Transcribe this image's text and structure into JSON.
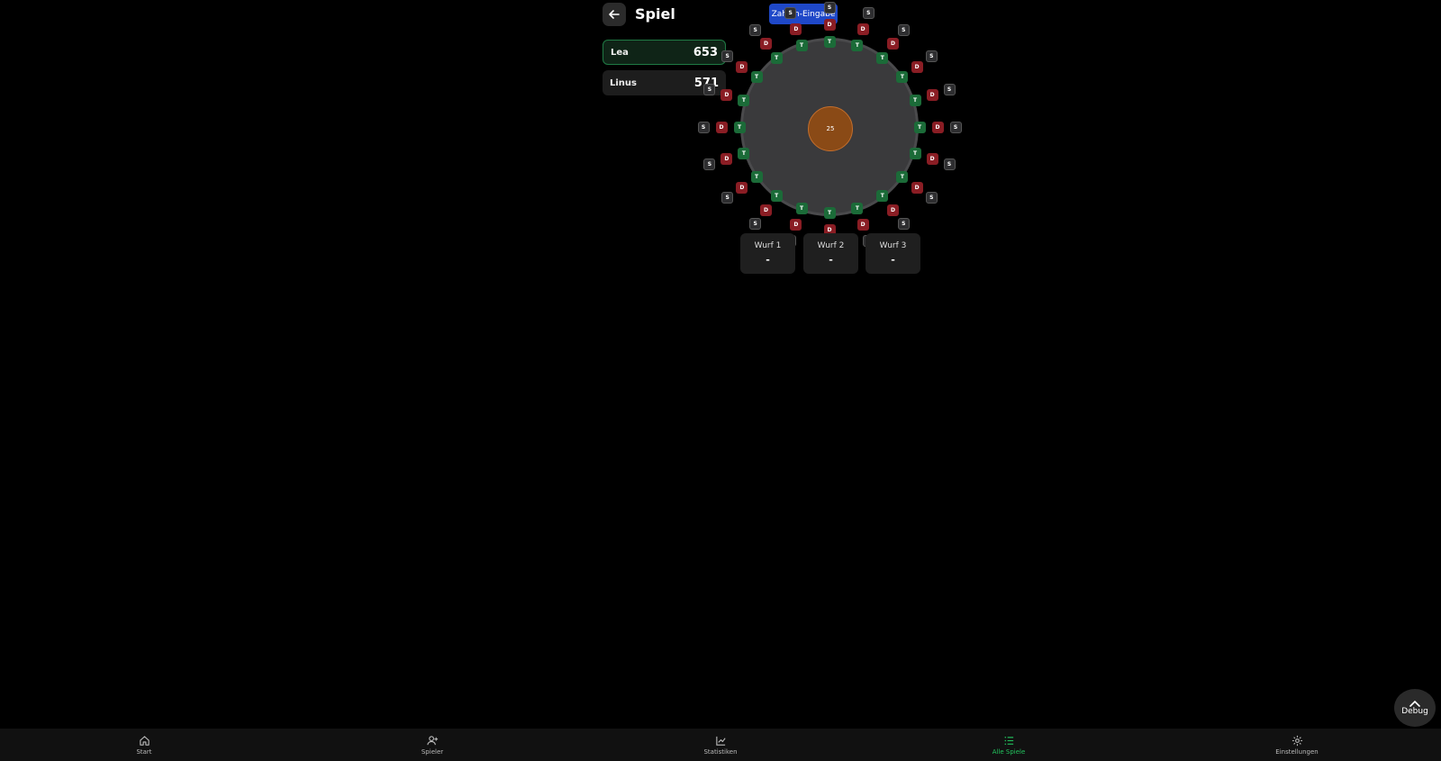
{
  "header": {
    "title": "Spiel",
    "mode_button": "Zahlen-Eingabe"
  },
  "players": [
    {
      "name": "Lea",
      "score": "653",
      "active": true
    },
    {
      "name": "Linus",
      "score": "571",
      "active": false
    }
  ],
  "board": {
    "bull_label": "25",
    "segment_labels": {
      "triple": "T",
      "double": "D",
      "single": "S"
    }
  },
  "throws": [
    {
      "label": "Wurf 1",
      "value": "-"
    },
    {
      "label": "Wurf 2",
      "value": "-"
    },
    {
      "label": "Wurf 3",
      "value": "-"
    }
  ],
  "debug_label": "Debug",
  "nav": [
    {
      "label": "Start",
      "icon": "home-icon",
      "active": false
    },
    {
      "label": "Spieler",
      "icon": "add-user-icon",
      "active": false
    },
    {
      "label": "Statistiken",
      "icon": "chart-icon",
      "active": false
    },
    {
      "label": "Alle Spiele",
      "icon": "list-icon",
      "active": true
    },
    {
      "label": "Einstellungen",
      "icon": "gear-icon",
      "active": false
    }
  ],
  "colors": {
    "accent": "#22c55e",
    "triple": "#1b6b38",
    "double": "#8a1d24",
    "bull": "#8a4a16",
    "mode_button": "#1f48c8"
  }
}
